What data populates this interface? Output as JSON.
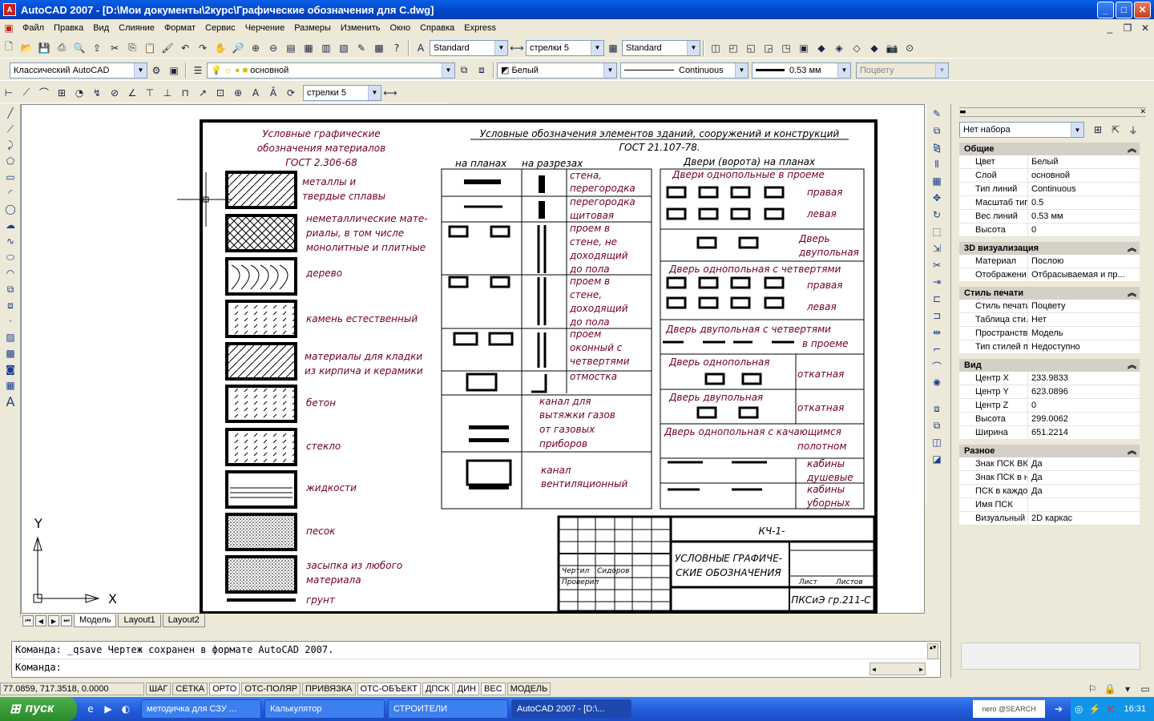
{
  "window": {
    "title": "AutoCAD 2007 - [D:\\Мои документы\\2курс\\Графические обозначения для С.dwg]",
    "minimize": "_",
    "maximize": "□",
    "close": "✕"
  },
  "menu": [
    "Файл",
    "Правка",
    "Вид",
    "Слияние",
    "Формат",
    "Сервис",
    "Черчение",
    "Размеры",
    "Изменить",
    "Окно",
    "Справка",
    "Express"
  ],
  "toolbar1": {
    "text_style": "Standard",
    "dim_style": "стрелки 5",
    "table_style": "Standard"
  },
  "toolbar2": {
    "workspace": "Классический AutoCAD",
    "layer": "основной",
    "color": "Белый",
    "linetype": "Continuous",
    "lineweight": "0.53 мм",
    "plotstyle": "Поцвету"
  },
  "toolbar3": {
    "dim_style": "стрелки 5"
  },
  "tabs": {
    "model": "Модель",
    "layout1": "Layout1",
    "layout2": "Layout2"
  },
  "drawing": {
    "left_title": [
      "Условные графические",
      "обозначения материалов",
      "ГОСТ 2.306-68"
    ],
    "main_title": [
      "Условные обозначения элементов зданий, сооружений и конструкций",
      "ГОСТ 21.107-78."
    ],
    "sub_plans": "на планах",
    "sub_sections": "на разрезах",
    "doors_title": "Двери (ворота) на планах",
    "materials": [
      "металлы и",
      "твердые сплавы",
      "неметаллические мате-",
      "риалы, в том числе",
      "монолитные и плитные",
      "дерево",
      "камень естественный",
      "материалы для кладки",
      "из кирпича и керамики",
      "бетон",
      "стекло",
      "жидкости",
      "песок",
      "засыпка из любого",
      "материала",
      "грунт"
    ],
    "elements": [
      "стена,",
      "перегородка",
      "перегородка",
      "щитовая",
      "проем в",
      "стене, не",
      "доходящий",
      "до пола",
      "проем в",
      "стене,",
      "доходящий",
      "до пола",
      "проем",
      "оконный с",
      "четвертями",
      "отмостка",
      "канал для",
      "вытяжки газов",
      "от газовых",
      "приборов",
      "канал",
      "вентиляционный"
    ],
    "doors": [
      "Двери однопольные в проеме",
      "правая",
      "левая",
      "Дверь",
      "двупольная",
      "Дверь однопольная с четвертями",
      "правая",
      "левая",
      "Дверь двупольная с четвертями",
      "в проеме",
      "Дверь однопольная",
      "откатная",
      "Дверь двупольная",
      "откатная",
      "Дверь однопольная с качающимся",
      "полотном",
      "кабины",
      "душевые",
      "кабины",
      "уборных"
    ],
    "stamp": {
      "code": "КЧ-1-",
      "title1": "УСЛОВНЫЕ ГРАФИЧЕ-",
      "title2": "СКИЕ ОБОЗНАЧЕНИЯ",
      "group": "ПКСиЭ гр.211-С",
      "r1": "Чертил",
      "r2": "Проверил",
      "r3": "Сидоров",
      "lit": "Лист",
      "lists": "Листов"
    },
    "ucs_x": "X",
    "ucs_y": "Y"
  },
  "properties": {
    "selection": "Нет набора",
    "sections": [
      {
        "title": "Общие",
        "rows": [
          [
            "Цвет",
            "Белый"
          ],
          [
            "Слой",
            "основной"
          ],
          [
            "Тип линий",
            "Continuous"
          ],
          [
            "Масштаб тип...",
            "0.5"
          ],
          [
            "Вес линий",
            "0.53 мм"
          ],
          [
            "Высота",
            "0"
          ]
        ]
      },
      {
        "title": "3D визуализация",
        "rows": [
          [
            "Материал",
            "Послою"
          ],
          [
            "Отображени...",
            "Отбрасываемая и пр..."
          ]
        ]
      },
      {
        "title": "Стиль печати",
        "rows": [
          [
            "Стиль печати",
            "Поцвету"
          ],
          [
            "Таблица сти...",
            "Нет"
          ],
          [
            "Пространств...",
            "Модель"
          ],
          [
            "Тип стилей п...",
            "Недоступно"
          ]
        ]
      },
      {
        "title": "Вид",
        "rows": [
          [
            "Центр X",
            "233.9833"
          ],
          [
            "Центр Y",
            "623.0896"
          ],
          [
            "Центр Z",
            "0"
          ],
          [
            "Высота",
            "299.0062"
          ],
          [
            "Ширина",
            "651.2214"
          ]
        ]
      },
      {
        "title": "Разное",
        "rows": [
          [
            "Знак ПСК ВКЛ",
            "Да"
          ],
          [
            "Знак ПСК в н...",
            "Да"
          ],
          [
            "ПСК в каждо...",
            "Да"
          ],
          [
            "Имя ПСК",
            ""
          ],
          [
            "Визуальный ...",
            "2D каркас"
          ]
        ]
      }
    ]
  },
  "command": {
    "line1": "Команда: _qsave Чертеж сохранен в формате AutoCAD 2007.",
    "line2": "Команда:"
  },
  "status": {
    "coords": "77.0859, 717.3518, 0.0000",
    "modes": [
      "ШАГ",
      "СЕТКА",
      "ОРТО",
      "ОТС-ПОЛЯР",
      "ПРИВЯЗКА",
      "ОТС-ОБЪЕКТ",
      "ДПСК",
      "ДИН",
      "ВЕС",
      "МОДЕЛЬ"
    ]
  },
  "taskbar": {
    "start": "пуск",
    "tasks": [
      "методичка для СЗУ ...",
      "Калькулятор",
      "СТРОИТЕЛИ",
      "AutoCAD 2007 - [D:\\..."
    ],
    "clock": "16:31",
    "nero": "nero @SEARCH"
  }
}
